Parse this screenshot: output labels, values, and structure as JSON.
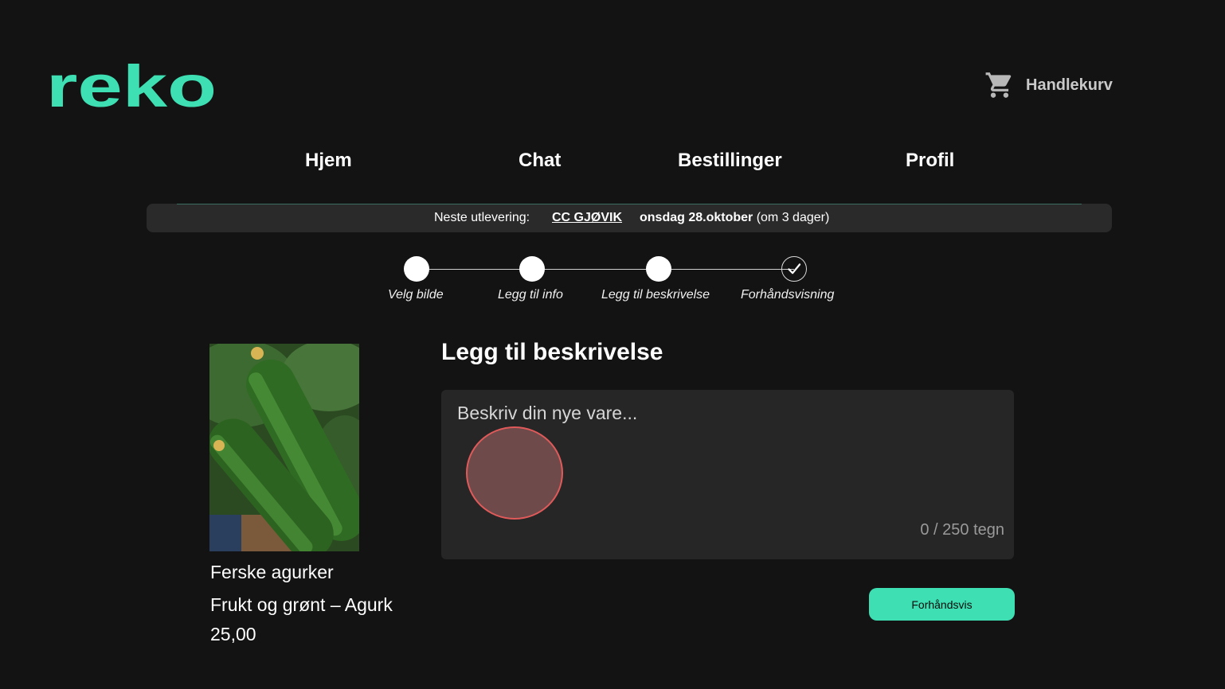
{
  "brand": {
    "logo_text": "reko",
    "accent": "#3ee0b3"
  },
  "header": {
    "cart_label": "Handlekurv",
    "cart_icon": "shopping-cart-icon"
  },
  "nav": {
    "items": [
      {
        "label": "Hjem"
      },
      {
        "label": "Chat"
      },
      {
        "label": "Bestillinger"
      },
      {
        "label": "Profil"
      }
    ]
  },
  "delivery": {
    "label": "Neste utlevering:",
    "location": "CC GJØVIK",
    "date": "onsdag 28.oktober",
    "relative": "(om 3 dager)"
  },
  "stepper": {
    "steps": [
      {
        "label": "Velg bilde"
      },
      {
        "label": "Legg til info"
      },
      {
        "label": "Legg til beskrivelse"
      },
      {
        "label": "Forhåndsvisning"
      }
    ],
    "final_icon": "check-icon"
  },
  "product": {
    "name": "Ferske agurker",
    "category": "Frukt og grønt – Agurk",
    "price": "25,00",
    "image": "cucumber-photo"
  },
  "form": {
    "title": "Legg til beskrivelse",
    "description_value": "",
    "description_placeholder": "Beskriv din nye vare...",
    "counter": "0 / 250 tegn",
    "preview_button": "Forhåndsvis"
  },
  "colors": {
    "background": "#131313",
    "panel": "#262626",
    "bar": "#2a2a2a",
    "button": "#3ee0b3",
    "touch_marker": "#e05a5a"
  }
}
